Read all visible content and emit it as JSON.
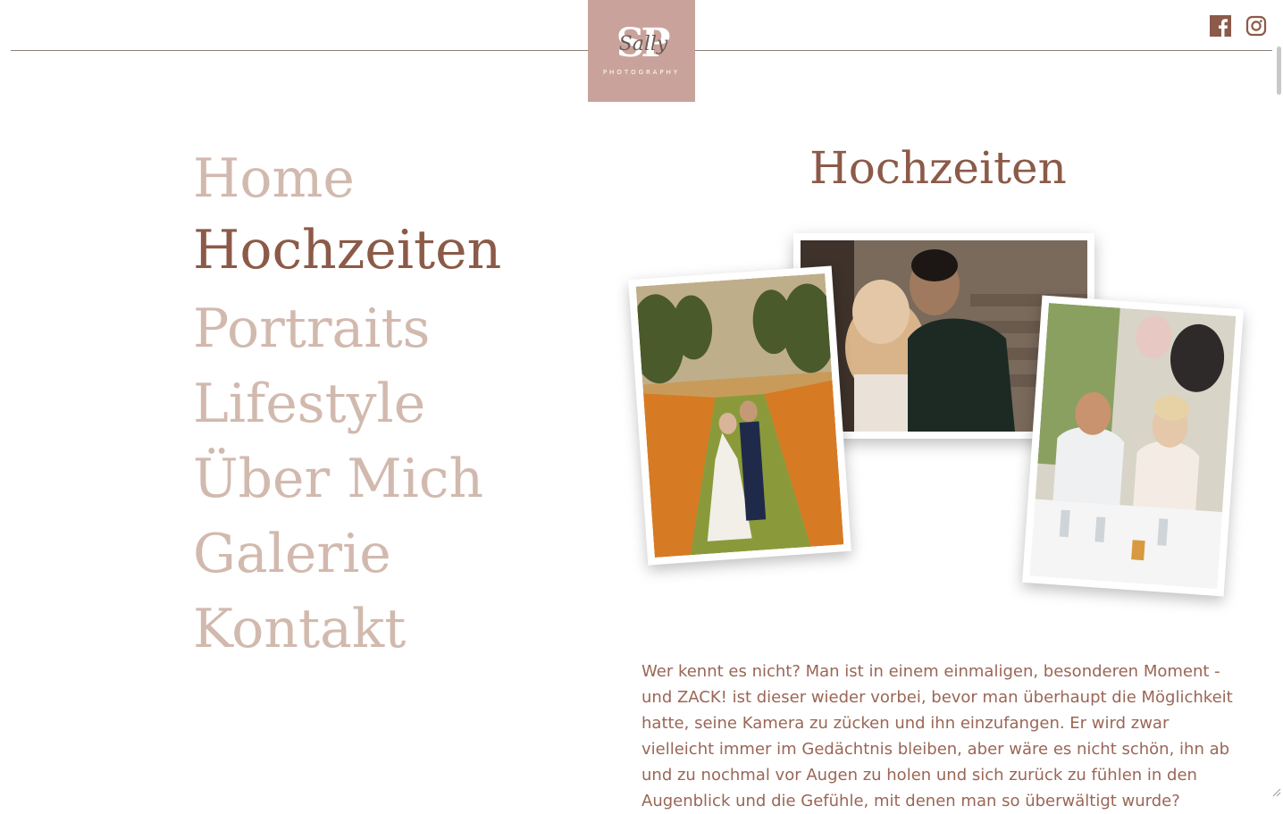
{
  "brand": {
    "logo_initials": "SP",
    "logo_script": "Sally",
    "logo_subtitle": "PHOTOGRAPHY",
    "logo_color": "#c9a39b"
  },
  "social": [
    {
      "icon": "facebook-icon",
      "color": "#8c5a48"
    },
    {
      "icon": "instagram-icon",
      "color": "#8c5a48"
    }
  ],
  "nav": {
    "items": [
      {
        "label": "Home",
        "active": false
      },
      {
        "label": "Hochzeiten",
        "active": true
      },
      {
        "label": "Portraits",
        "active": false
      },
      {
        "label": "Lifestyle",
        "active": false
      },
      {
        "label": "Über Mich",
        "active": false
      },
      {
        "label": "Galerie",
        "active": false
      },
      {
        "label": "Kontakt",
        "active": false
      }
    ],
    "active_color": "#8c5a48",
    "inactive_color": "#d2b9ae"
  },
  "main": {
    "title": "Hochzeiten",
    "photos": [
      {
        "subject": "wedding couple standing in a garden alley"
      },
      {
        "subject": "couple kissing in front of stairs"
      },
      {
        "subject": "couple at wedding table with balloons"
      }
    ],
    "intro": "Wer kennt es nicht? Man ist in einem einmaligen, besonderen Moment - und ZACK! ist dieser wieder vorbei, bevor man überhaupt die Möglichkeit hatte, seine Kamera zu zücken und ihn einzufangen. Er wird zwar vielleicht immer im Gedächtnis bleiben, aber wäre es nicht schön, ihn ab und zu nochmal vor Augen zu holen und sich zurück zu fühlen in den Augenblick und die Gefühle, mit denen man so überwältigt wurde?"
  }
}
